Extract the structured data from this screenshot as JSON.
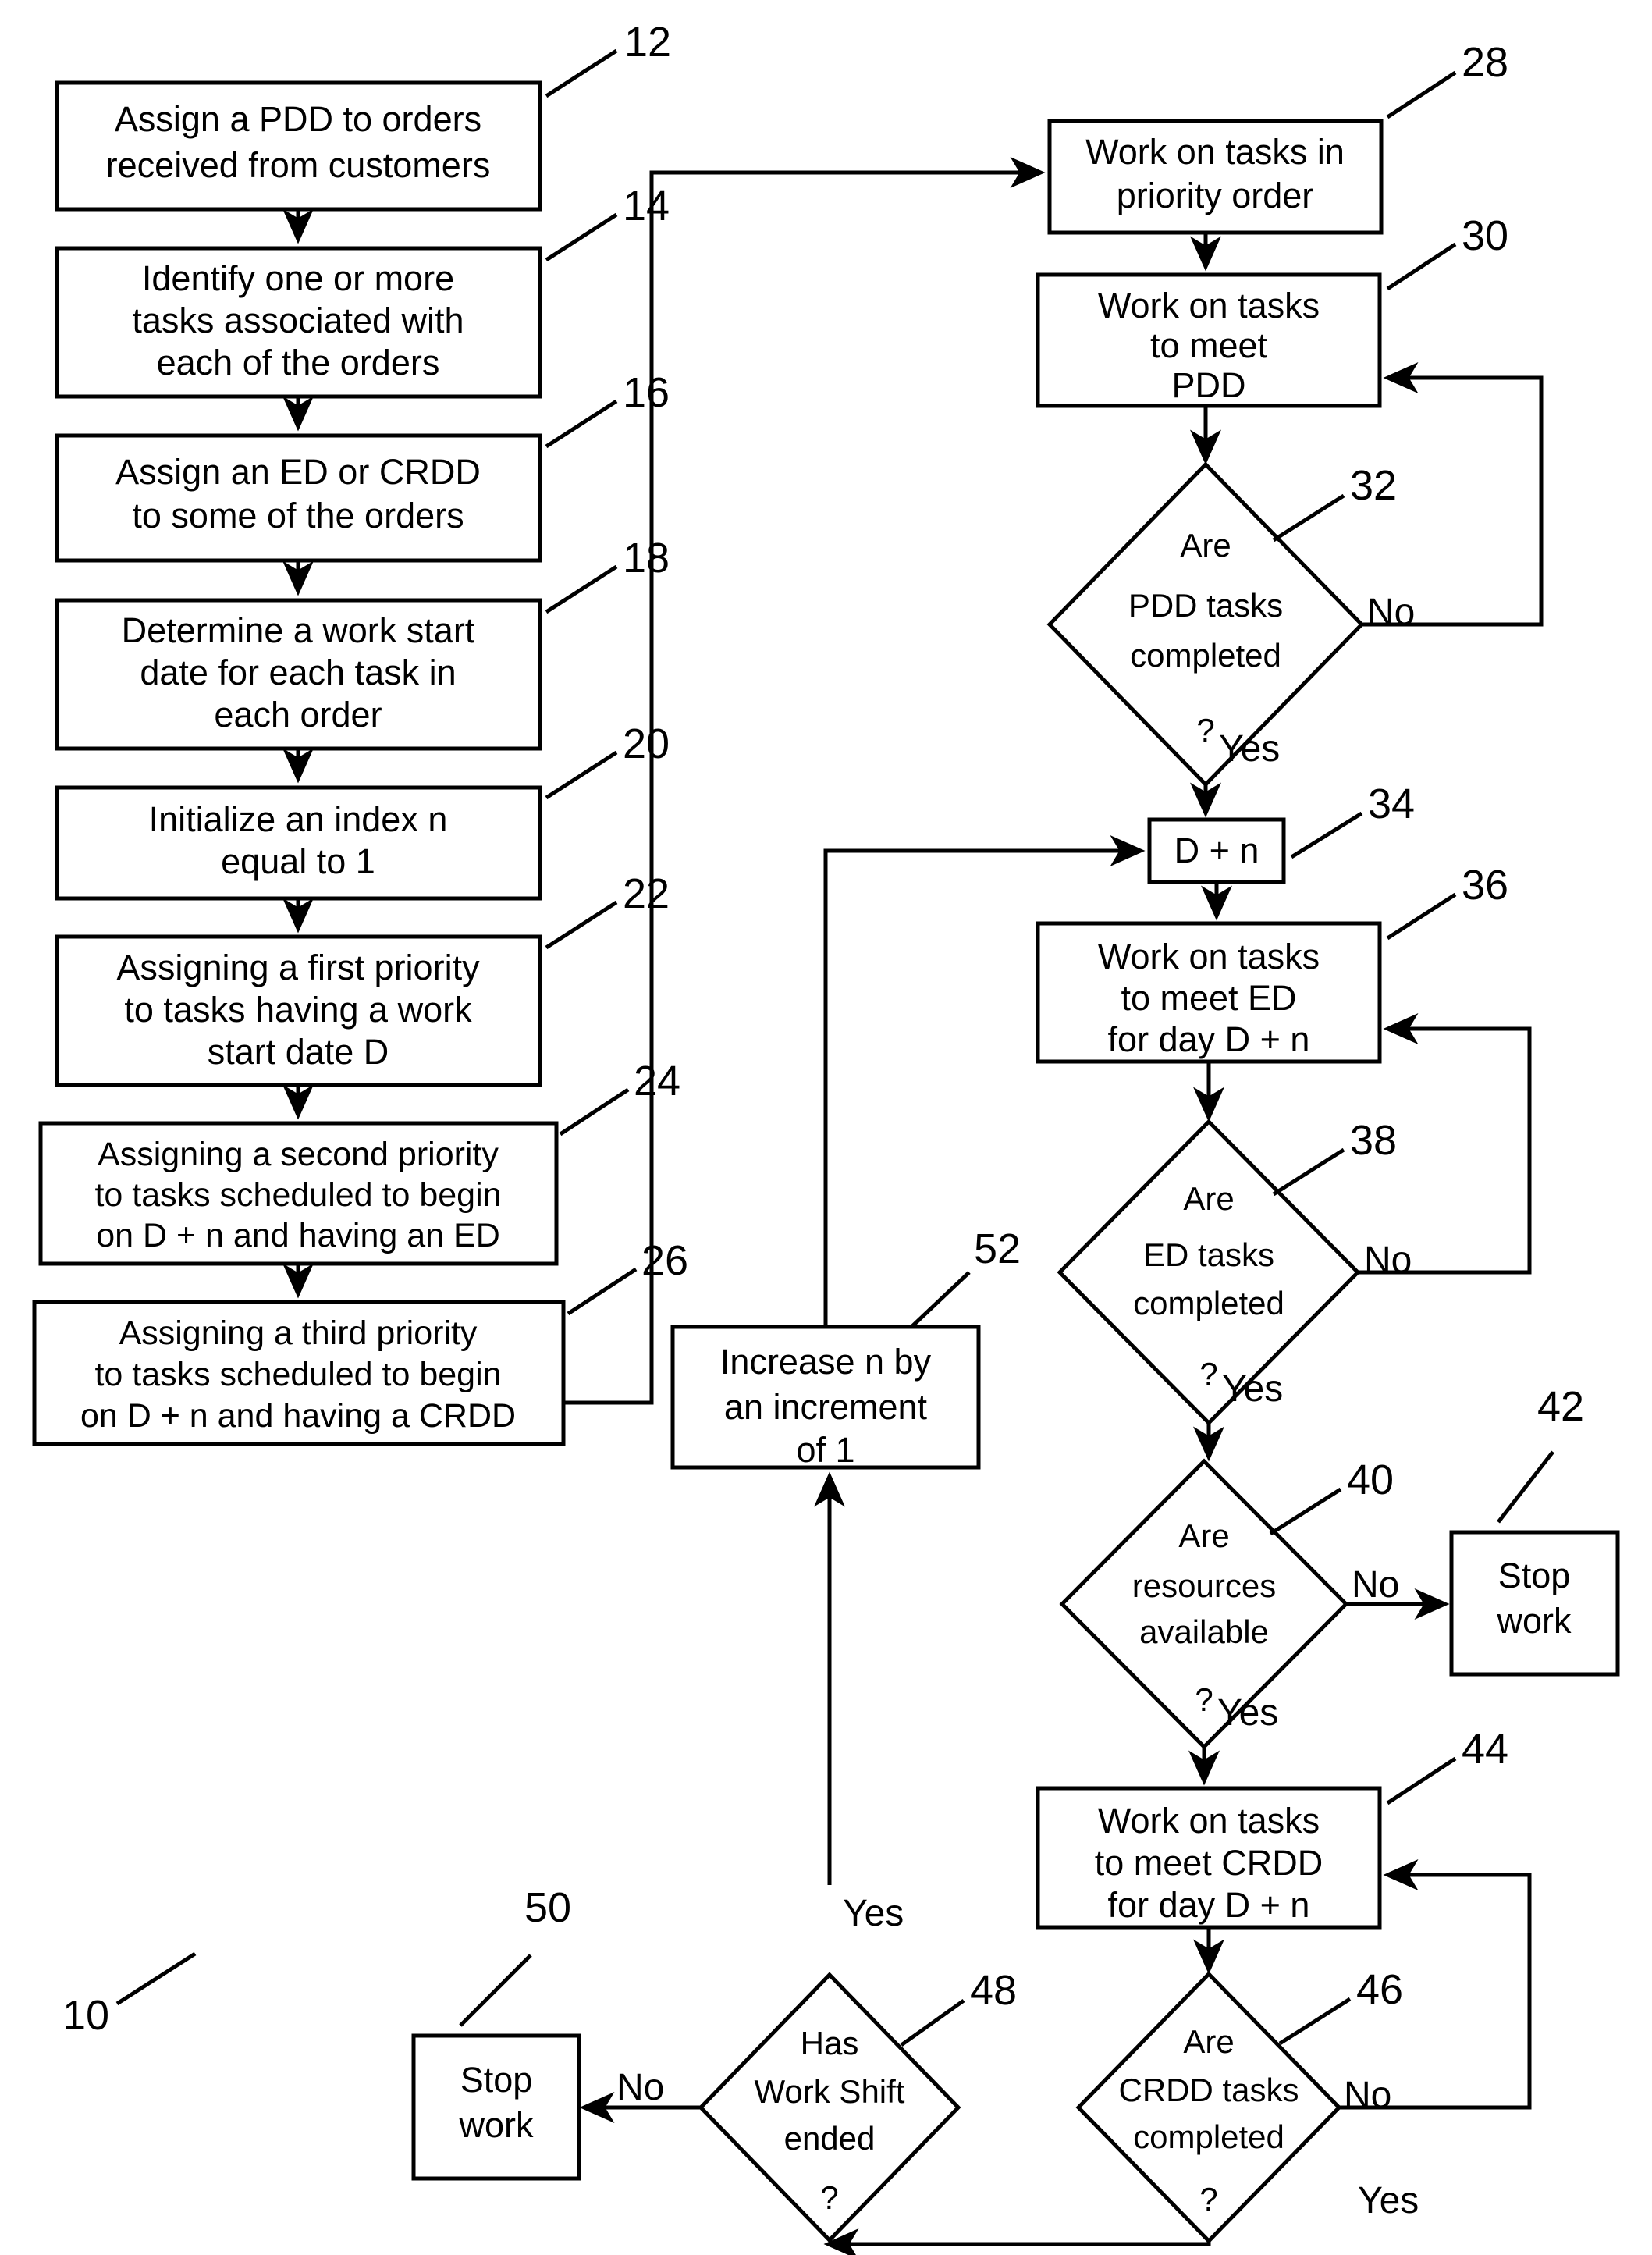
{
  "figure": {
    "reference_numeral": "10",
    "type": "flowchart"
  },
  "process_boxes": [
    {
      "id": "12",
      "ref": "12",
      "lines": [
        "Assign a PDD to orders",
        "received from customers"
      ]
    },
    {
      "id": "14",
      "ref": "14",
      "lines": [
        "Identify one or more",
        "tasks associated with",
        "each of the orders"
      ]
    },
    {
      "id": "16",
      "ref": "16",
      "lines": [
        "Assign an ED or CRDD",
        "to some of the orders"
      ]
    },
    {
      "id": "18",
      "ref": "18",
      "lines": [
        "Determine a work start",
        "date for each task in",
        "each order"
      ]
    },
    {
      "id": "20",
      "ref": "20",
      "lines": [
        "Initialize an index n",
        "equal to 1"
      ]
    },
    {
      "id": "22",
      "ref": "22",
      "lines": [
        "Assigning a first priority",
        "to tasks having a work",
        "start date D"
      ]
    },
    {
      "id": "24",
      "ref": "24",
      "lines": [
        "Assigning a second priority",
        "to tasks scheduled to begin",
        "on D + n and having an ED"
      ]
    },
    {
      "id": "26",
      "ref": "26",
      "lines": [
        "Assigning a third priority",
        "to  tasks scheduled to begin",
        "on D + n and having a CRDD"
      ]
    },
    {
      "id": "28",
      "ref": "28",
      "lines": [
        "Work on tasks in",
        "priority order"
      ]
    },
    {
      "id": "30",
      "ref": "30",
      "lines": [
        "Work on tasks",
        "to meet",
        "PDD"
      ]
    },
    {
      "id": "34",
      "ref": "34",
      "lines": [
        "D + n"
      ]
    },
    {
      "id": "36",
      "ref": "36",
      "lines": [
        "Work on tasks",
        "to meet ED",
        "for day D + n"
      ]
    },
    {
      "id": "42",
      "ref": "42",
      "lines": [
        "Stop",
        "work"
      ]
    },
    {
      "id": "44",
      "ref": "44",
      "lines": [
        "Work on tasks",
        "to meet CRDD",
        "for day D + n"
      ]
    },
    {
      "id": "50",
      "ref": "50",
      "lines": [
        "Stop",
        "work"
      ]
    },
    {
      "id": "52",
      "ref": "52",
      "lines": [
        "Increase n by",
        "an increment",
        "of 1"
      ]
    }
  ],
  "decision_diamonds": [
    {
      "id": "32",
      "ref": "32",
      "lines": [
        "Are",
        "PDD tasks",
        "completed",
        "?"
      ],
      "yes_label": "Yes",
      "no_label": "No"
    },
    {
      "id": "38",
      "ref": "38",
      "lines": [
        "Are",
        "ED tasks",
        "completed",
        "?"
      ],
      "yes_label": "Yes",
      "no_label": "No"
    },
    {
      "id": "40",
      "ref": "40",
      "lines": [
        "Are",
        "resources",
        "available",
        "?"
      ],
      "yes_label": "Yes",
      "no_label": "No"
    },
    {
      "id": "46",
      "ref": "46",
      "lines": [
        "Are",
        "CRDD tasks",
        "completed",
        "?"
      ],
      "yes_label": "Yes",
      "no_label": "No"
    },
    {
      "id": "48",
      "ref": "48",
      "lines": [
        "Has",
        "Work Shift",
        "ended",
        "?"
      ],
      "yes_label": "Yes",
      "no_label": "No"
    }
  ],
  "colors": {
    "stroke": "#000000",
    "fill": "#ffffff",
    "background": "#ffffff"
  }
}
